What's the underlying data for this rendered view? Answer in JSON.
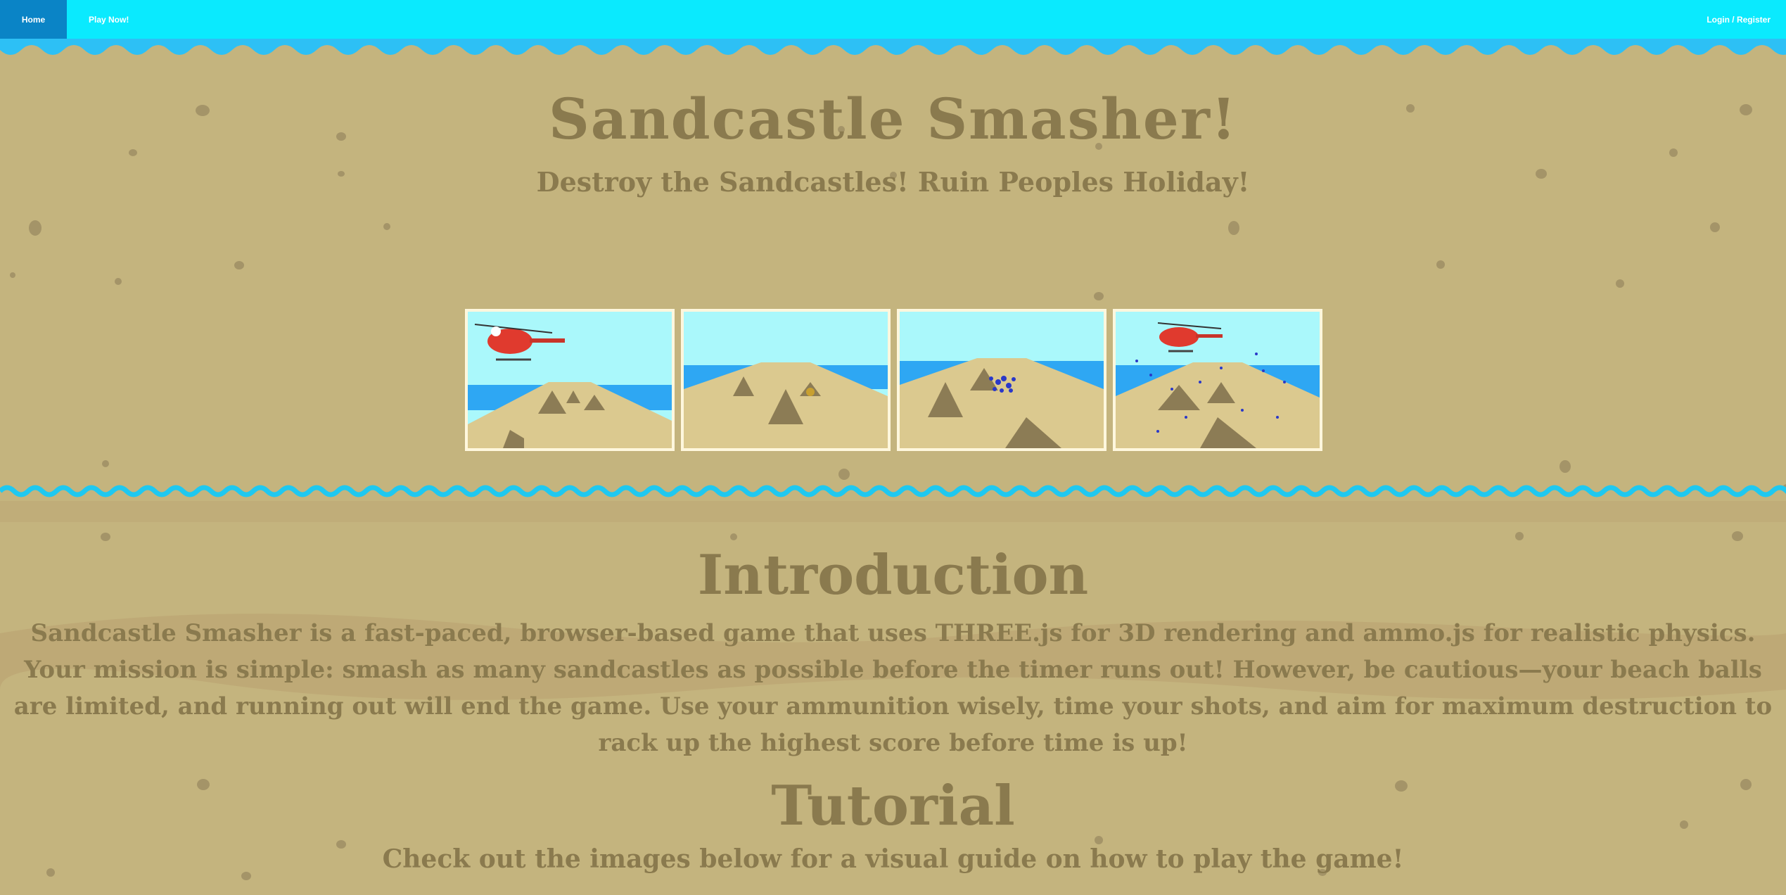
{
  "nav": {
    "home_label": "Home",
    "play_label": "Play Now!",
    "login_label": "Login / Register"
  },
  "colors": {
    "nav_bg": "#0aeafe",
    "nav_active": "#0a84c6",
    "sand": "#c4b47e",
    "text": "#8a7a4e",
    "water": "#1fc8f0"
  },
  "hero": {
    "title": "Sandcastle Smasher!",
    "subtitle": "Destroy the Sandcastles! Ruin Peoples Holiday!"
  },
  "gallery": [
    {
      "name": "helicopter-over-beach"
    },
    {
      "name": "sandcastles-on-beach"
    },
    {
      "name": "beach-balls-hitting-castle"
    },
    {
      "name": "helicopter-smashing-castles"
    }
  ],
  "intro": {
    "heading": "Introduction",
    "text": "Sandcastle Smasher is a fast-paced, browser-based game that uses THREE.js for 3D rendering and ammo.js for realistic physics. Your mission is simple: smash as many sandcastles as possible before the timer runs out! However, be cautious—your beach balls are limited, and running out will end the game. Use your ammunition wisely, time your shots, and aim for maximum destruction to rack up the highest score before time is up!"
  },
  "tutorial": {
    "heading": "Tutorial",
    "text": "Check out the images below for a visual guide on how to play the game!"
  }
}
